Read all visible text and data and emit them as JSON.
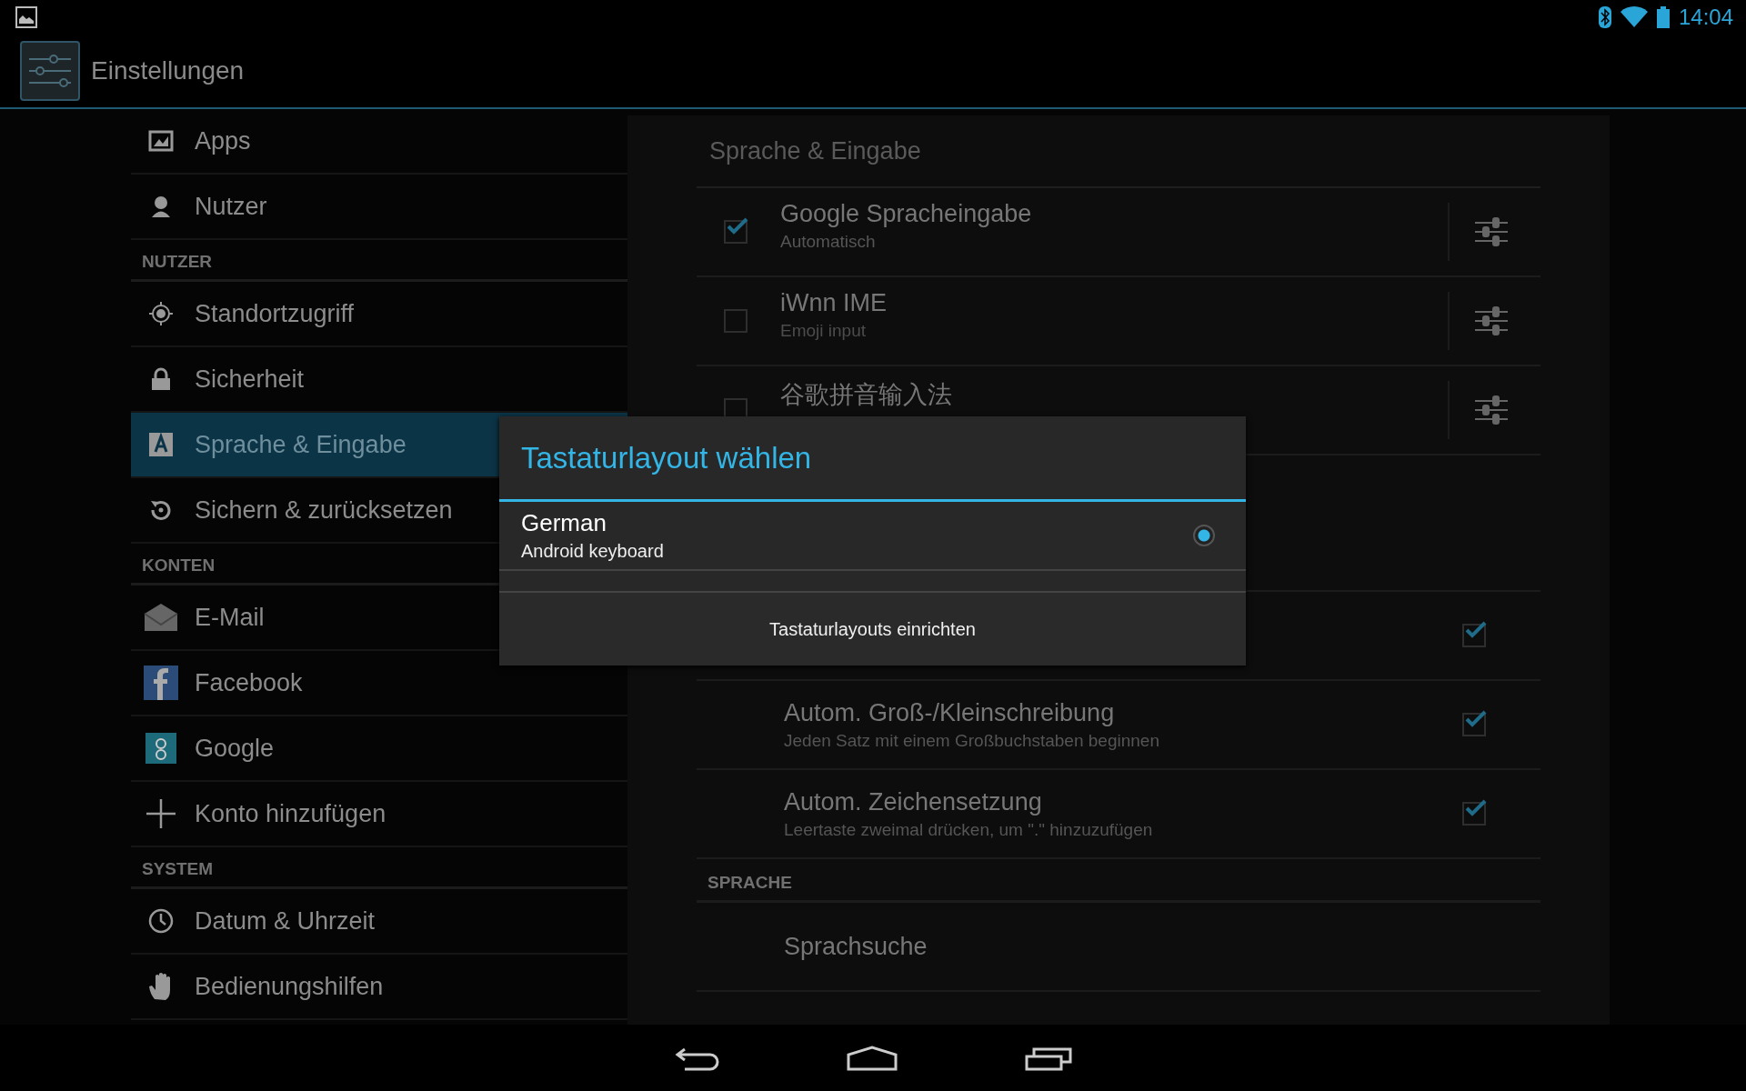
{
  "status_bar": {
    "time": "14:04"
  },
  "action_bar": {
    "title": "Einstellungen"
  },
  "sidebar": [
    {
      "kind": "item",
      "label": "Apps",
      "selected": false
    },
    {
      "kind": "item",
      "label": "Nutzer",
      "selected": false
    },
    {
      "kind": "header",
      "label": "NUTZER"
    },
    {
      "kind": "item",
      "label": "Standortzugriff",
      "selected": false
    },
    {
      "kind": "item",
      "label": "Sicherheit",
      "selected": false
    },
    {
      "kind": "item",
      "label": "Sprache & Eingabe",
      "selected": true
    },
    {
      "kind": "item",
      "label": "Sichern & zurücksetzen",
      "selected": false
    },
    {
      "kind": "header",
      "label": "KONTEN"
    },
    {
      "kind": "item",
      "label": "E-Mail",
      "selected": false
    },
    {
      "kind": "item",
      "label": "Facebook",
      "selected": false
    },
    {
      "kind": "item",
      "label": "Google",
      "selected": false
    },
    {
      "kind": "item",
      "label": "Konto hinzufügen",
      "selected": false
    },
    {
      "kind": "header",
      "label": "SYSTEM"
    },
    {
      "kind": "item",
      "label": "Datum & Uhrzeit",
      "selected": false
    },
    {
      "kind": "item",
      "label": "Bedienungshilfen",
      "selected": false
    }
  ],
  "panel": {
    "title": "Sprache & Eingabe",
    "rows": [
      {
        "kind": "ime",
        "title": "Google Spracheingabe",
        "subtitle": "Automatisch",
        "checked": true
      },
      {
        "kind": "ime",
        "title": "iWnn IME",
        "subtitle": "Emoji input",
        "checked": false
      },
      {
        "kind": "ime",
        "title": "谷歌拼音输入法",
        "checked": false
      },
      {
        "kind": "blank"
      },
      {
        "kind": "toggle",
        "checked": true
      },
      {
        "kind": "toggle",
        "title": "Autom. Groß-/Kleinschreibung",
        "subtitle": "Jeden Satz mit einem Großbuchstaben beginnen",
        "checked": true
      },
      {
        "kind": "toggle",
        "title": "Autom. Zeichensetzung",
        "subtitle": "Leertaste zweimal drücken, um \".\" hinzuzufügen",
        "checked": true
      },
      {
        "kind": "header",
        "title": "SPRACHE"
      },
      {
        "kind": "plain",
        "title": "Sprachsuche"
      }
    ]
  },
  "dialog": {
    "title": "Tastaturlayout wählen",
    "options": [
      {
        "title": "German",
        "subtitle": "Android keyboard",
        "selected": true
      }
    ],
    "button": "Tastaturlayouts einrichten"
  }
}
